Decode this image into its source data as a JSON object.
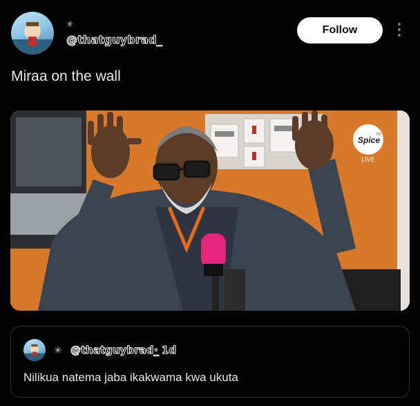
{
  "author": {
    "handle": "@thatguybrad_"
  },
  "actions": {
    "follow_label": "Follow"
  },
  "post": {
    "text": "Miraa on the wall"
  },
  "media": {
    "logo_text": "Spice",
    "logo_sub": "fm",
    "live_label": "LIVE"
  },
  "quote": {
    "handle": "@thatguybrad_",
    "time": "· 1d",
    "text": "Nilikua natema jaba ikakwama kwa ukuta"
  },
  "colors": {
    "background": "#000000",
    "follow_bg": "#ffffff",
    "border": "#2f3336",
    "studio_orange": "#d8782a"
  }
}
